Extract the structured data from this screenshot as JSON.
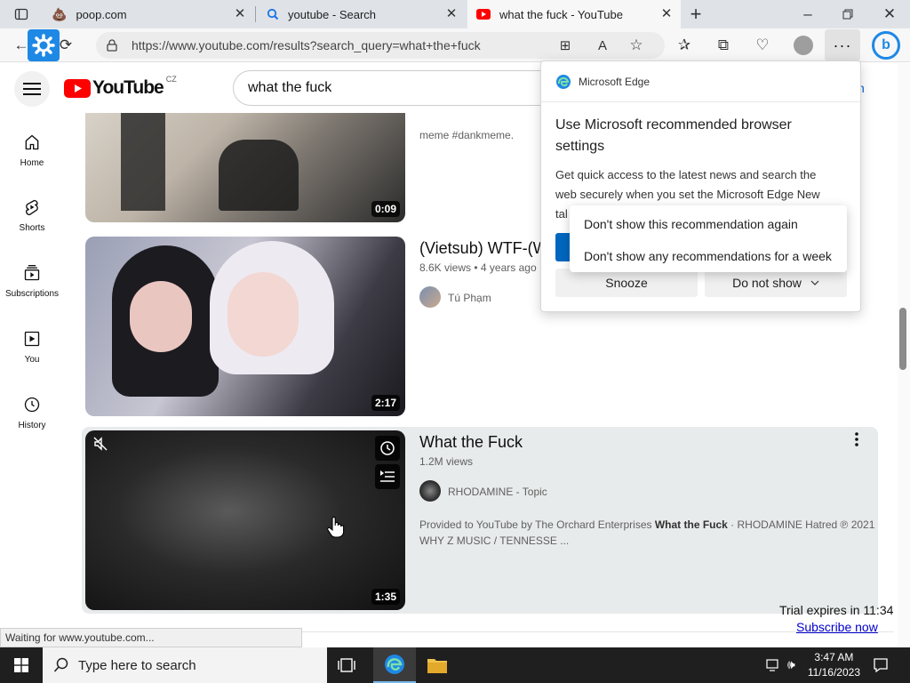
{
  "tabs": [
    {
      "title": "poop.com"
    },
    {
      "title": "youtube - Search"
    },
    {
      "title": "what the fuck - YouTube"
    }
  ],
  "address_bar": {
    "url": "https://www.youtube.com/results?search_query=what+the+fuck"
  },
  "youtube": {
    "logo_text": "YouTube",
    "region": "CZ",
    "search_value": "what the fuck",
    "signin_partial": "n"
  },
  "guide": [
    {
      "label": "Home",
      "icon": "home-icon"
    },
    {
      "label": "Shorts",
      "icon": "shorts-icon"
    },
    {
      "label": "Subscriptions",
      "icon": "subscriptions-icon"
    },
    {
      "label": "You",
      "icon": "you-icon"
    },
    {
      "label": "History",
      "icon": "history-icon"
    }
  ],
  "results": [
    {
      "duration": "0:09",
      "snippet": "meme #dankmeme."
    },
    {
      "title": "(Vietsub) WTF-(W",
      "views": "8.6K views",
      "age": "4 years ago",
      "channel": "Tú Phạm",
      "duration": "2:17"
    },
    {
      "title": "What the Fuck",
      "views": "1.2M views",
      "channel": "RHODAMINE - Topic",
      "desc_prefix": "Provided to YouTube by The Orchard Enterprises ",
      "desc_bold": "What the Fuck",
      "desc_suffix": " · RHODAMINE Hatred ℗ 2021",
      "desc_line2": "WHY Z MUSIC / TENNESSE ...",
      "duration": "1:35"
    }
  ],
  "edge_popup": {
    "brand": "Microsoft Edge",
    "heading": "Use Microsoft recommended browser settings",
    "body_line1": "Get quick access to the latest news and search the",
    "body_line2": "web securely when you set the Microsoft Edge New",
    "body_line3_partial": "tal",
    "snooze_label": "Snooze",
    "dont_show_label": "Do not show"
  },
  "context_menu": {
    "item1": "Don't show this recommendation again",
    "item2": "Don't show any recommendations for a week"
  },
  "trial": {
    "text": "Trial expires in 11:34",
    "link": "Subscribe now"
  },
  "status_text": "Waiting for www.youtube.com...",
  "taskbar": {
    "search_placeholder": "Type here to search",
    "time": "3:47 AM",
    "date": "11/16/2023"
  },
  "colors": {
    "youtube_red": "#ff0000",
    "edge_blue": "#0067c0",
    "subscribe_link": "#0000cc",
    "hover_row": "#e8ebeb"
  }
}
